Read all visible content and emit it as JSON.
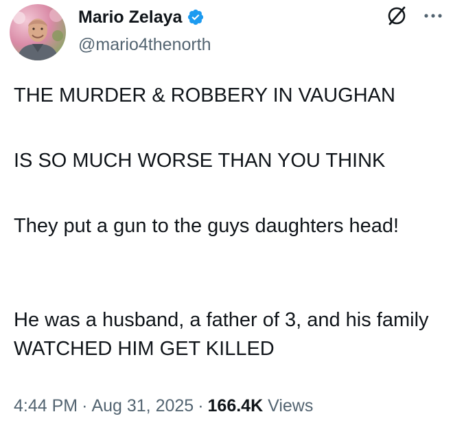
{
  "author": {
    "display_name": "Mario Zelaya",
    "handle": "@mario4thenorth",
    "verified": true,
    "verified_color": "#1d9bf0"
  },
  "header_actions": {
    "grok_icon": "grok-icon",
    "more_icon": "more-horizontal-icon"
  },
  "tweet": {
    "paragraphs": [
      "THE MURDER & ROBBERY IN VAUGHAN",
      "IS SO MUCH WORSE THAN YOU THINK",
      "They put a gun to the guys daughters head!",
      "He was a husband, a father of 3, and his family WATCHED HIM GET KILLED"
    ]
  },
  "meta": {
    "time": "4:44 PM",
    "separator": "·",
    "date": "Aug 31, 2025",
    "views_count": "166.4K",
    "views_label": "Views"
  },
  "colors": {
    "text_primary": "#0f1419",
    "text_secondary": "#536471",
    "accent": "#1d9bf0"
  }
}
